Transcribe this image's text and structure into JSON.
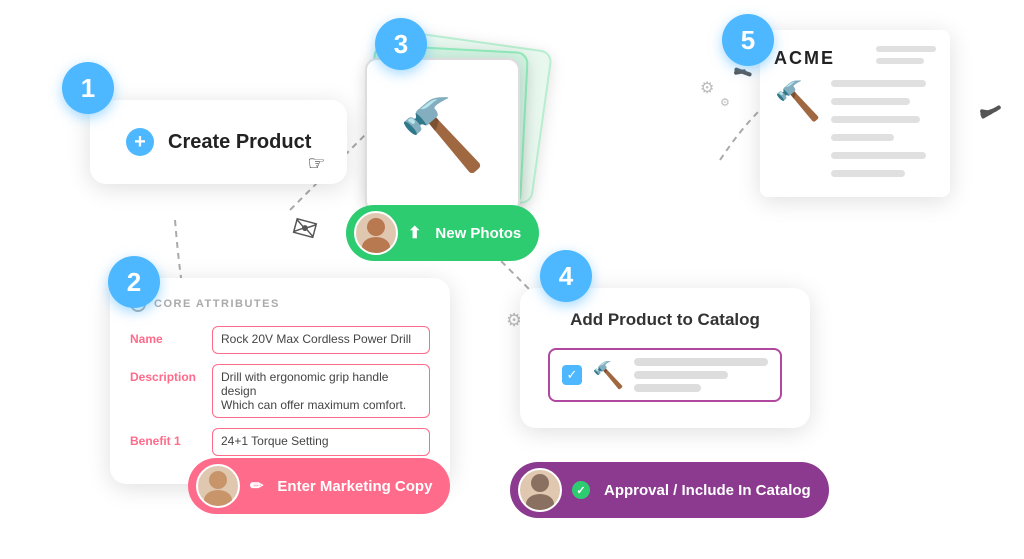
{
  "steps": [
    {
      "number": "1",
      "label": "Create Product"
    },
    {
      "number": "2",
      "label": "Enter Marketing Copy"
    },
    {
      "number": "3",
      "label": "New Photos"
    },
    {
      "number": "4",
      "label": "Approval / Include In Catalog"
    },
    {
      "number": "5",
      "label": "ACME"
    }
  ],
  "step1": {
    "button_label": "Create Product",
    "plus": "+"
  },
  "step2": {
    "header": "CORE ATTRIBUTES",
    "fields": [
      {
        "label": "Name",
        "value": "Rock 20V Max Cordless Power Drill"
      },
      {
        "label": "Description",
        "value": "Drill with ergonomic grip handle design\nWhich can offer maximum comfort."
      },
      {
        "label": "Benefit 1",
        "value": "24+1 Torque Setting"
      }
    ],
    "badge_label": "Enter Marketing Copy"
  },
  "step3": {
    "badge_label": "New Photos"
  },
  "step4": {
    "title": "Add Product to Catalog",
    "badge_label": "Approval / Include In Catalog"
  },
  "step5": {
    "acme": "ACME"
  },
  "icons": {
    "gear": "⚙",
    "envelope": "✉",
    "cursor": "☞",
    "check": "✓",
    "upload": "⬆",
    "pencil": "✏",
    "checkCircle": "✓"
  }
}
